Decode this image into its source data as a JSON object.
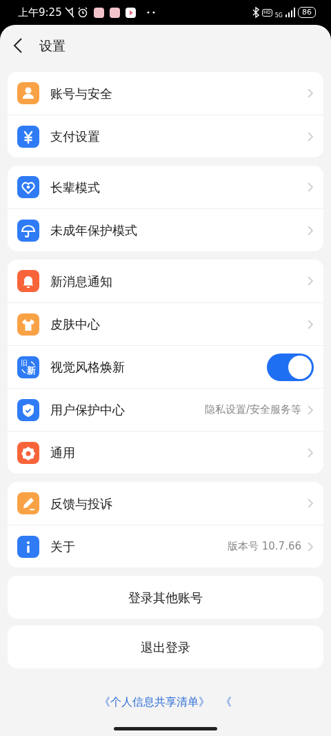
{
  "status_bar": {
    "time": "上午9:25",
    "hd": "HD",
    "network": "5G",
    "battery": "86"
  },
  "header": {
    "title": "设置"
  },
  "groups": [
    {
      "items": [
        {
          "kind": "link",
          "label": "账号与安全"
        },
        {
          "kind": "link",
          "label": "支付设置"
        }
      ]
    },
    {
      "items": [
        {
          "kind": "link",
          "label": "长辈模式"
        },
        {
          "kind": "link",
          "label": "未成年保护模式"
        }
      ]
    },
    {
      "items": [
        {
          "kind": "link",
          "label": "新消息通知"
        },
        {
          "kind": "link",
          "label": "皮肤中心"
        },
        {
          "kind": "toggle",
          "icon_text": [
            "旧",
            "新"
          ],
          "label": "视觉风格焕新",
          "on": true
        },
        {
          "kind": "link",
          "label": "用户保护中心",
          "value": "隐私设置/安全服务等"
        },
        {
          "kind": "link",
          "label": "通用"
        }
      ]
    },
    {
      "items": [
        {
          "kind": "link",
          "label": "反馈与投诉"
        },
        {
          "kind": "link",
          "label": "关于",
          "value": "版本号 10.7.66"
        }
      ]
    }
  ],
  "buttons": [
    "登录其他账号",
    "退出登录"
  ],
  "footer_links": [
    "《个人信息共享清单》",
    "《"
  ]
}
